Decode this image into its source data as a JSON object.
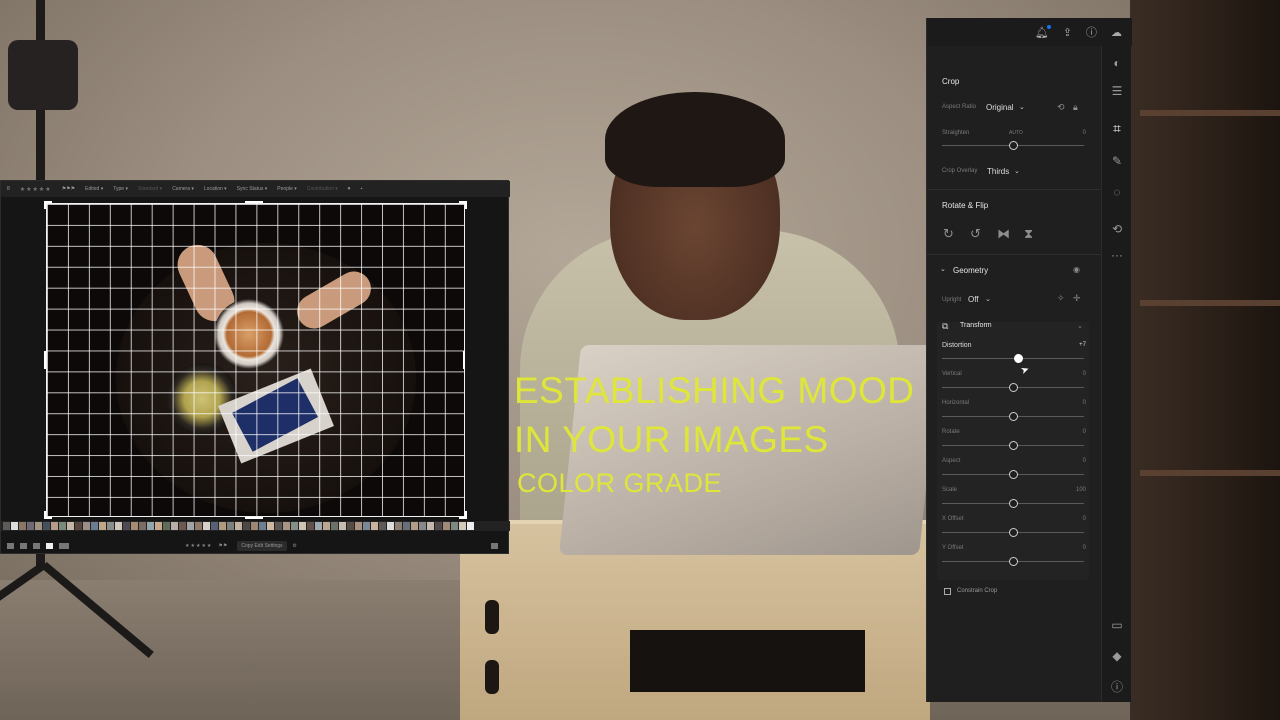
{
  "title_overlay": {
    "line1": "ESTABLISHING MOOD",
    "line2": "IN YOUR IMAGES",
    "line3": "COLOR GRADE",
    "color": "#dfe63a"
  },
  "app_window": {
    "filter_bar": {
      "count": "8",
      "stars": "★★★★★",
      "filters": [
        "Edited",
        "Type",
        "Standard",
        "Camera",
        "Location",
        "Sync Status",
        "People",
        "Contribution"
      ]
    },
    "bottom_bar": {
      "rating": "★★★★★",
      "copy_button": "Copy Edit Settings"
    }
  },
  "panel": {
    "top_icons": [
      "bell-icon",
      "share-icon",
      "help-icon",
      "cloud-icon"
    ],
    "crop": {
      "title": "Crop",
      "aspect_ratio_label": "Aspect Ratio",
      "aspect_ratio_value": "Original",
      "straighten_label": "Straighten",
      "straighten_auto": "AUTO",
      "straighten_value": "0",
      "straighten_level": 0.5,
      "crop_overlay_label": "Crop Overlay",
      "crop_overlay_value": "Thirds"
    },
    "rotate_flip": {
      "title": "Rotate & Flip",
      "icons": [
        "rotate-clockwise-icon",
        "rotate-counterclockwise-icon",
        "flip-horizontal-icon",
        "flip-vertical-icon"
      ]
    },
    "geometry": {
      "title": "Geometry",
      "upright_label": "Upright",
      "upright_value": "Off",
      "transform_title": "Transform",
      "sliders": [
        {
          "label": "Distortion",
          "value": "+7",
          "level": 0.54
        },
        {
          "label": "Vertical",
          "value": "0",
          "level": 0.5
        },
        {
          "label": "Horizontal",
          "value": "0",
          "level": 0.5
        },
        {
          "label": "Rotate",
          "value": "0",
          "level": 0.5
        },
        {
          "label": "Aspect",
          "value": "0",
          "level": 0.5
        },
        {
          "label": "Scale",
          "value": "100",
          "level": 0.5
        },
        {
          "label": "X Offset",
          "value": "0",
          "level": 0.5
        },
        {
          "label": "Y Offset",
          "value": "0",
          "level": 0.5
        }
      ],
      "constrain_crop_label": "Constrain Crop"
    },
    "tools": [
      "presets-icon",
      "edit-sliders-icon",
      "crop-icon",
      "healing-icon",
      "masking-icon",
      "history-icon",
      "more-icon",
      "comments-icon",
      "keywords-icon",
      "info-icon"
    ]
  }
}
